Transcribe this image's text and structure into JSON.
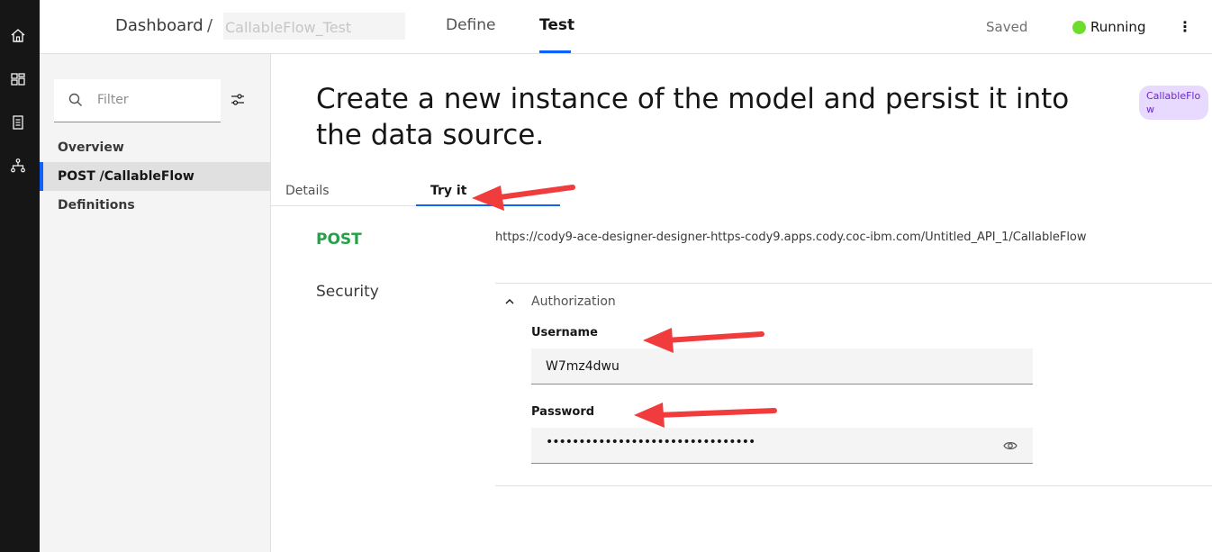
{
  "rail": {
    "icons": [
      "home-icon",
      "dashboard-icon",
      "catalog-icon",
      "flow-icon"
    ]
  },
  "header": {
    "breadcrumb_root": "Dashboard",
    "breadcrumb_sep": "/",
    "flow_name_input": "CallableFlow_Test",
    "tabs": [
      {
        "label": "Define",
        "active": false
      },
      {
        "label": "Test",
        "active": true
      }
    ],
    "save_status": "Saved",
    "run_status": "Running",
    "run_status_color": "#6fdc2c",
    "overflow_icon": "overflow-menu-icon"
  },
  "sidebar": {
    "filter_placeholder": "Filter",
    "items": [
      {
        "label": "Overview",
        "active": false
      },
      {
        "label": "POST /CallableFlow",
        "active": true
      },
      {
        "label": "Definitions",
        "active": false
      }
    ]
  },
  "main": {
    "title": "Create a new instance of the model and persist it into the data source.",
    "tag": "CallableFlow",
    "subtabs": [
      {
        "label": "Details",
        "active": false
      },
      {
        "label": "Try it",
        "active": true
      }
    ],
    "method": "POST",
    "method_color": "#24a148",
    "url": "https://cody9-ace-designer-designer-https-cody9.apps.cody.coc-ibm.com/Untitled_API_1/CallableFlow",
    "security_label": "Security",
    "authorization_label": "Authorization",
    "username_label": "Username",
    "username_value": "W7mz4dwu",
    "password_label": "Password",
    "password_masked": "••••••••••••••••••••••••••••••••"
  },
  "accent_color": "#0f62fe",
  "annotation_color": "#f03c3c"
}
